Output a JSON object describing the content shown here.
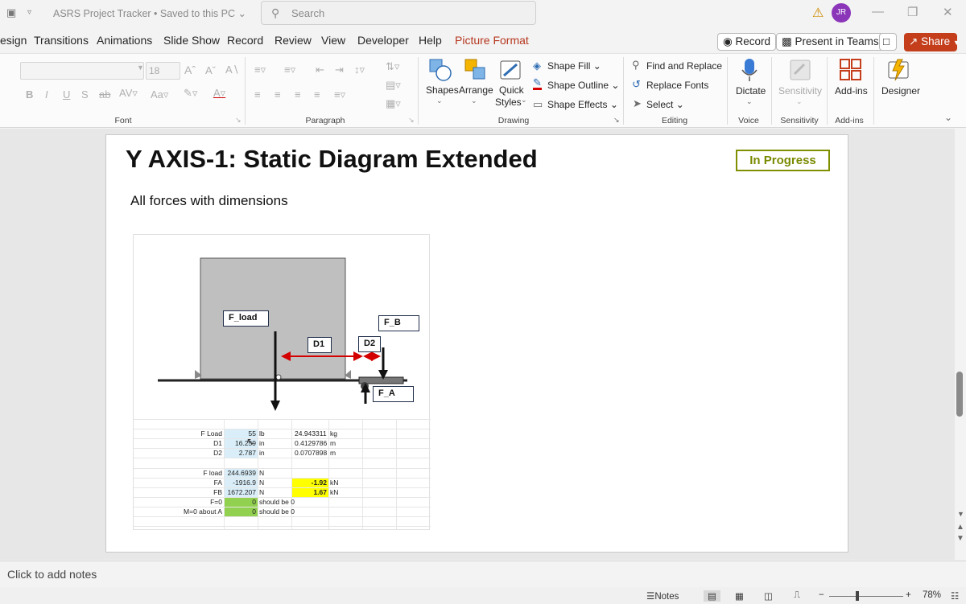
{
  "window": {
    "doc_title": "ASRS Project Tracker • Saved to this PC ⌄",
    "search_placeholder": "Search",
    "user_initials": "JR"
  },
  "menu": {
    "tabs": [
      "esign",
      "Transitions",
      "Animations",
      "Slide Show",
      "Record",
      "Review",
      "View",
      "Developer",
      "Help",
      "Picture Format"
    ],
    "record_button": "Record",
    "teams_button": "Present in Teams",
    "share_button": "Share"
  },
  "ribbon": {
    "font": {
      "size_value": "18",
      "group_label": "Font"
    },
    "paragraph": {
      "group_label": "Paragraph"
    },
    "drawing": {
      "shapes": "Shapes",
      "arrange": "Arrange",
      "quick_styles_1": "Quick",
      "quick_styles_2": "Styles",
      "shape_fill": "Shape Fill",
      "shape_outline": "Shape Outline",
      "shape_effects": "Shape Effects",
      "group_label": "Drawing"
    },
    "editing": {
      "find_replace": "Find and Replace",
      "replace_fonts": "Replace Fonts",
      "select": "Select",
      "group_label": "Editing"
    },
    "voice": {
      "dictate": "Dictate",
      "group_label": "Voice"
    },
    "sensitivity": {
      "label": "Sensitivity",
      "group_label": "Sensitivity"
    },
    "addins": {
      "label": "Add-ins",
      "group_label": "Add-ins"
    },
    "designer": {
      "label": "Designer"
    }
  },
  "slide": {
    "title": "Y AXIS-1: Static Diagram Extended",
    "status": "In Progress",
    "subtitle": "All forces with dimensions",
    "diagram_labels": {
      "f_load": "F_load",
      "f_b": "F_B",
      "d1": "D1",
      "d2": "D2",
      "f_a": "F_A"
    },
    "table": {
      "rows": [
        {
          "label": "F Load",
          "value": "55",
          "unit": "lb",
          "conv": "24.943311",
          "conv_unit": "kg"
        },
        {
          "label": "D1",
          "value": "16.259",
          "unit": "in",
          "conv": "0.4129786",
          "conv_unit": "m"
        },
        {
          "label": "D2",
          "value": "2.787",
          "unit": "in",
          "conv": "0.0707898",
          "conv_unit": "m"
        },
        {
          "label": "F load",
          "value": "244.6939",
          "unit": "N",
          "conv": "",
          "conv_unit": ""
        },
        {
          "label": "FA",
          "value": "-1916.9",
          "unit": "N",
          "conv": "-1.92",
          "conv_unit": "kN"
        },
        {
          "label": "FB",
          "value": "1672.207",
          "unit": "N",
          "conv": "1.67",
          "conv_unit": "kN"
        },
        {
          "label": "F=0",
          "value": "0",
          "unit": "should be 0",
          "conv": "",
          "conv_unit": ""
        },
        {
          "label": "M=0 about A",
          "value": "0",
          "unit": "should be 0",
          "conv": "",
          "conv_unit": ""
        }
      ]
    }
  },
  "notes": {
    "placeholder": "Click to add notes"
  },
  "statusbar": {
    "notes_label": "Notes",
    "zoom": "78%"
  },
  "colors": {
    "share": "#c43e1c",
    "accent_tab": "#b5361e",
    "status_border": "#7f8f00",
    "arrow_red": "#d40000",
    "cell_blue": "#d9eef9",
    "cell_yellow": "#ffff00",
    "cell_green": "#92d050"
  }
}
